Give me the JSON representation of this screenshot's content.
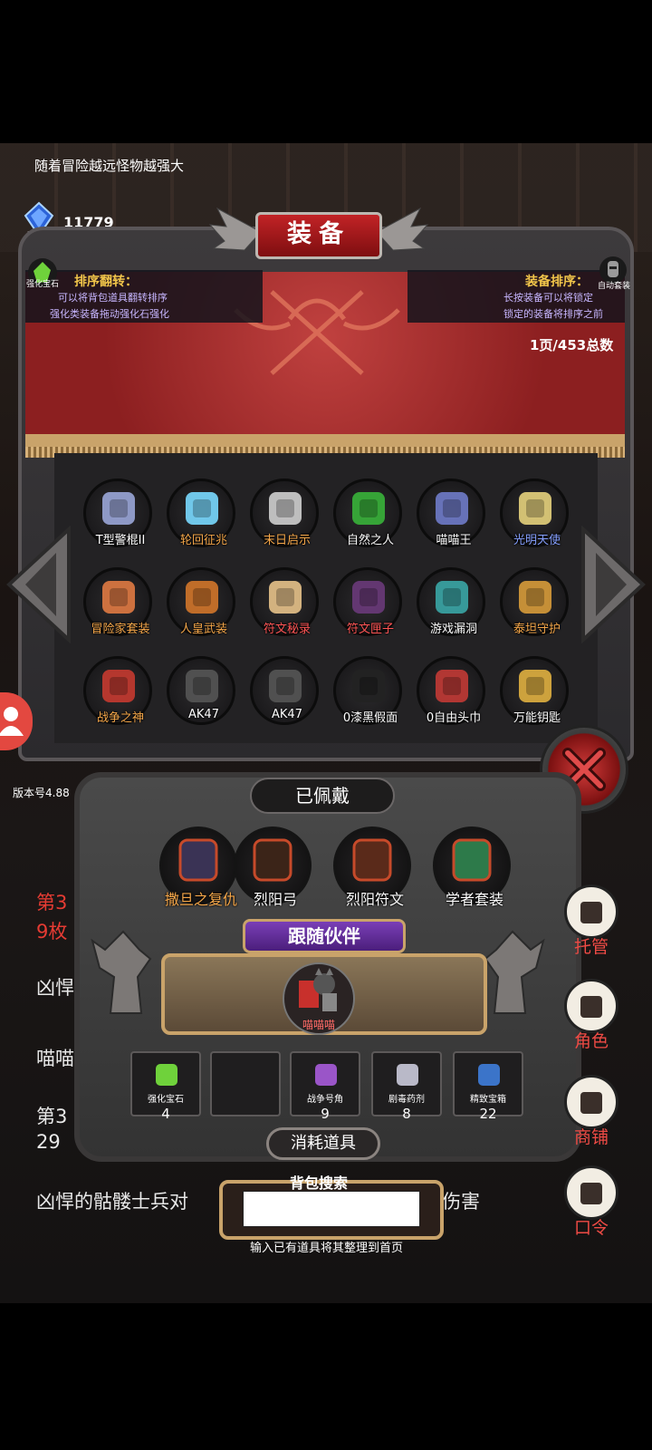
{
  "top_tip": "随着冒险越远怪物越强大",
  "gems": {
    "value": "11779",
    "label": "宝石"
  },
  "panel": {
    "title": "装备",
    "strength_gem_label": "强化宝石",
    "sort_flip": {
      "title": "排序翻转：",
      "line1": "可以将背包道具翻转排序",
      "line2": "强化类装备拖动强化石强化"
    },
    "equip_sort": {
      "title": "装备排序：",
      "line1": "长按装备可以将锁定",
      "line2": "锁定的装备将排序之前"
    },
    "auto_equip_label": "自动套装",
    "page_count": "1页/453总数"
  },
  "grid_items": [
    {
      "label": "T型警棍II",
      "icon": "baton-icon",
      "color": "#9aa6d8"
    },
    {
      "label": "轮回征兆",
      "icon": "ice-staff-icon",
      "color": "#79d9ff"
    },
    {
      "label": "末日启示",
      "icon": "axe-icon",
      "color": "#cfcfcf"
    },
    {
      "label": "自然之人",
      "icon": "green-armor-icon",
      "color": "#38b33a"
    },
    {
      "label": "喵喵王",
      "icon": "cat-king-icon",
      "color": "#6f7bc9"
    },
    {
      "label": "光明天使",
      "icon": "angel-icon",
      "color": "#e5d27c"
    },
    {
      "label": "冒险家套装",
      "icon": "adventurer-icon",
      "color": "#e07a42"
    },
    {
      "label": "人皇武装",
      "icon": "emperor-armor-icon",
      "color": "#d2752a"
    },
    {
      "label": "符文秘录",
      "icon": "horn-icon",
      "color": "#e7c28a"
    },
    {
      "label": "符文匣子",
      "icon": "rune-box-icon",
      "color": "#6a3a7a"
    },
    {
      "label": "游戏漏洞",
      "icon": "portal-icon",
      "color": "#3aa6a6"
    },
    {
      "label": "泰坦守护",
      "icon": "titan-icon",
      "color": "#d79b3a"
    },
    {
      "label": "战争之神",
      "icon": "war-god-icon",
      "color": "#c53a30"
    },
    {
      "label": "AK47",
      "icon": "rifle-icon",
      "color": "#555"
    },
    {
      "label": "AK47",
      "icon": "rifle-icon",
      "color": "#555"
    },
    {
      "label": "0漆黑假面",
      "icon": "mask-icon",
      "color": "#222"
    },
    {
      "label": "0自由头巾",
      "icon": "bandana-icon",
      "color": "#c23a35"
    },
    {
      "label": "万能钥匙",
      "icon": "key-icon",
      "color": "#e0b040"
    }
  ],
  "grid_label_colors": [
    "#fff",
    "#f5a74a",
    "#f5a74a",
    "#fff",
    "#fff",
    "#86a0ff",
    "#f5a74a",
    "#f5a74a",
    "#f55",
    "#f55",
    "#fff",
    "#f5a74a",
    "#f5a74a",
    "#fff",
    "#fff",
    "#fff",
    "#fff",
    "#fff"
  ],
  "version": "版本号4.88",
  "equipped": {
    "title": "已佩戴",
    "items": [
      {
        "label": "撒旦之复仇",
        "icon": "demon-wings-icon",
        "color": "#f5a74a"
      },
      {
        "label": "烈阳弓",
        "icon": "bow-icon",
        "color": "#fff"
      },
      {
        "label": "烈阳符文",
        "icon": "rune-icon",
        "color": "#fff"
      },
      {
        "label": "学者套装",
        "icon": "scholar-icon",
        "color": "#fff"
      }
    ]
  },
  "companion": {
    "title": "跟随伙伴",
    "name": "喵喵喵"
  },
  "consumables": {
    "title": "消耗道具",
    "items": [
      {
        "name": "强化宝石",
        "count": "4",
        "icon": "strength-gem-icon"
      },
      {
        "name": "",
        "count": "",
        "icon": "empty-slot-icon"
      },
      {
        "name": "战争号角",
        "count": "9",
        "icon": "war-horn-icon"
      },
      {
        "name": "剧毒药剂",
        "count": "8",
        "icon": "poison-icon"
      },
      {
        "name": "精致宝箱",
        "count": "22",
        "icon": "chest-icon"
      }
    ]
  },
  "search": {
    "title": "背包搜索",
    "hint": "输入已有道具将其整理到首页",
    "value": ""
  },
  "log": [
    "第3",
    "9枚",
    "凶悍",
    "喵喵",
    "第3",
    "29",
    "凶悍的骷髅士兵对",
    "伤害"
  ],
  "side_buttons": [
    {
      "label": "托管",
      "icon": "dice-icon"
    },
    {
      "label": "角色",
      "icon": "hooded-figure-icon"
    },
    {
      "label": "商铺",
      "icon": "shop-icon"
    },
    {
      "label": "口令",
      "icon": "scroll-icon"
    }
  ]
}
